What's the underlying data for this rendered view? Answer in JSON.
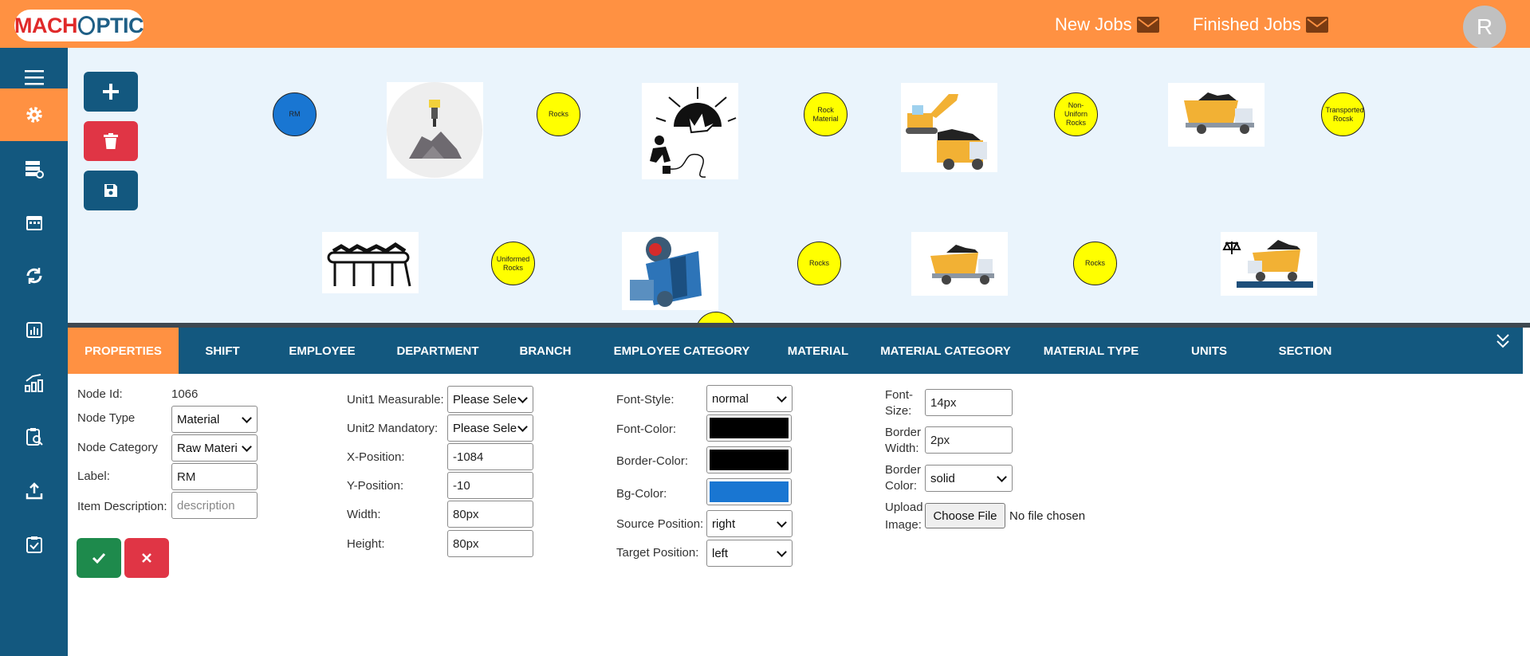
{
  "brand": {
    "logo_a": "MACH",
    "logo_b": "PTIC"
  },
  "header": {
    "new_jobs": "New Jobs",
    "finished_jobs": "Finished Jobs",
    "avatar_initial": "R"
  },
  "sidebar": {
    "items": [
      "menu-icon",
      "gear-icon",
      "database-icon",
      "calendar-icon",
      "sync-icon",
      "report-icon",
      "analytics-icon",
      "inspect-icon",
      "upload-icon",
      "checklist-icon"
    ],
    "active_index": 1
  },
  "toolbar": {
    "add": "+",
    "delete": "trash",
    "save": "save"
  },
  "flow_nodes": {
    "rm": "RM",
    "rocks1": "Rocks",
    "rock_material": "Rock Material",
    "non_uniform": "Non-Uniforn Rocks",
    "transported": "Transported Rocsk",
    "uniformed": "Uniformed Rocks",
    "rocks2": "Rocks",
    "rocks3": "Rocks"
  },
  "tabs": [
    "PROPERTIES",
    "SHIFT",
    "EMPLOYEE",
    "DEPARTMENT",
    "BRANCH",
    "EMPLOYEE CATEGORY",
    "MATERIAL",
    "MATERIAL CATEGORY",
    "MATERIAL TYPE",
    "UNITS",
    "SECTION"
  ],
  "properties": {
    "node_id_label": "Node Id:",
    "node_id_value": "1066",
    "node_type_label": "Node Type",
    "node_type_value": "Material",
    "node_category_label": "Node Category",
    "node_category_value": "Raw Materi",
    "label_label": "Label:",
    "label_value": "RM",
    "item_desc_label": "Item Description:",
    "item_desc_placeholder": "description",
    "unit1_label": "Unit1 Measurable:",
    "unit1_value": "Please Sele",
    "unit2_label": "Unit2 Mandatory:",
    "unit2_value": "Please Sele",
    "xpos_label": "X-Position:",
    "xpos_value": "-1084",
    "ypos_label": "Y-Position:",
    "ypos_value": "-10",
    "width_label": "Width:",
    "width_value": "80px",
    "height_label": "Height:",
    "height_value": "80px",
    "font_style_label": "Font-Style:",
    "font_style_value": "normal",
    "font_color_label": "Font-Color:",
    "font_color_value": "#000000",
    "border_color_label": "Border-Color:",
    "border_color_value": "#000000",
    "bg_color_label": "Bg-Color:",
    "bg_color_value": "#1976d2",
    "source_pos_label": "Source Position:",
    "source_pos_value": "right",
    "target_pos_label": "Target Position:",
    "target_pos_value": "left",
    "font_size_label": "Font-Size:",
    "font_size_value": "14px",
    "border_width_label": "Border Width:",
    "border_width_value": "2px",
    "border_color2_label": "Border Color:",
    "border_color2_value": "solid",
    "upload_label": "Upload Image:",
    "choose_file": "Choose File",
    "no_file": "No file chosen"
  },
  "colors": {
    "accent": "#FF9142",
    "primary": "#13587f",
    "danger": "#e03545",
    "success": "#1e8a4c",
    "node_yellow": "#ffff00",
    "node_blue": "#1976d2"
  }
}
